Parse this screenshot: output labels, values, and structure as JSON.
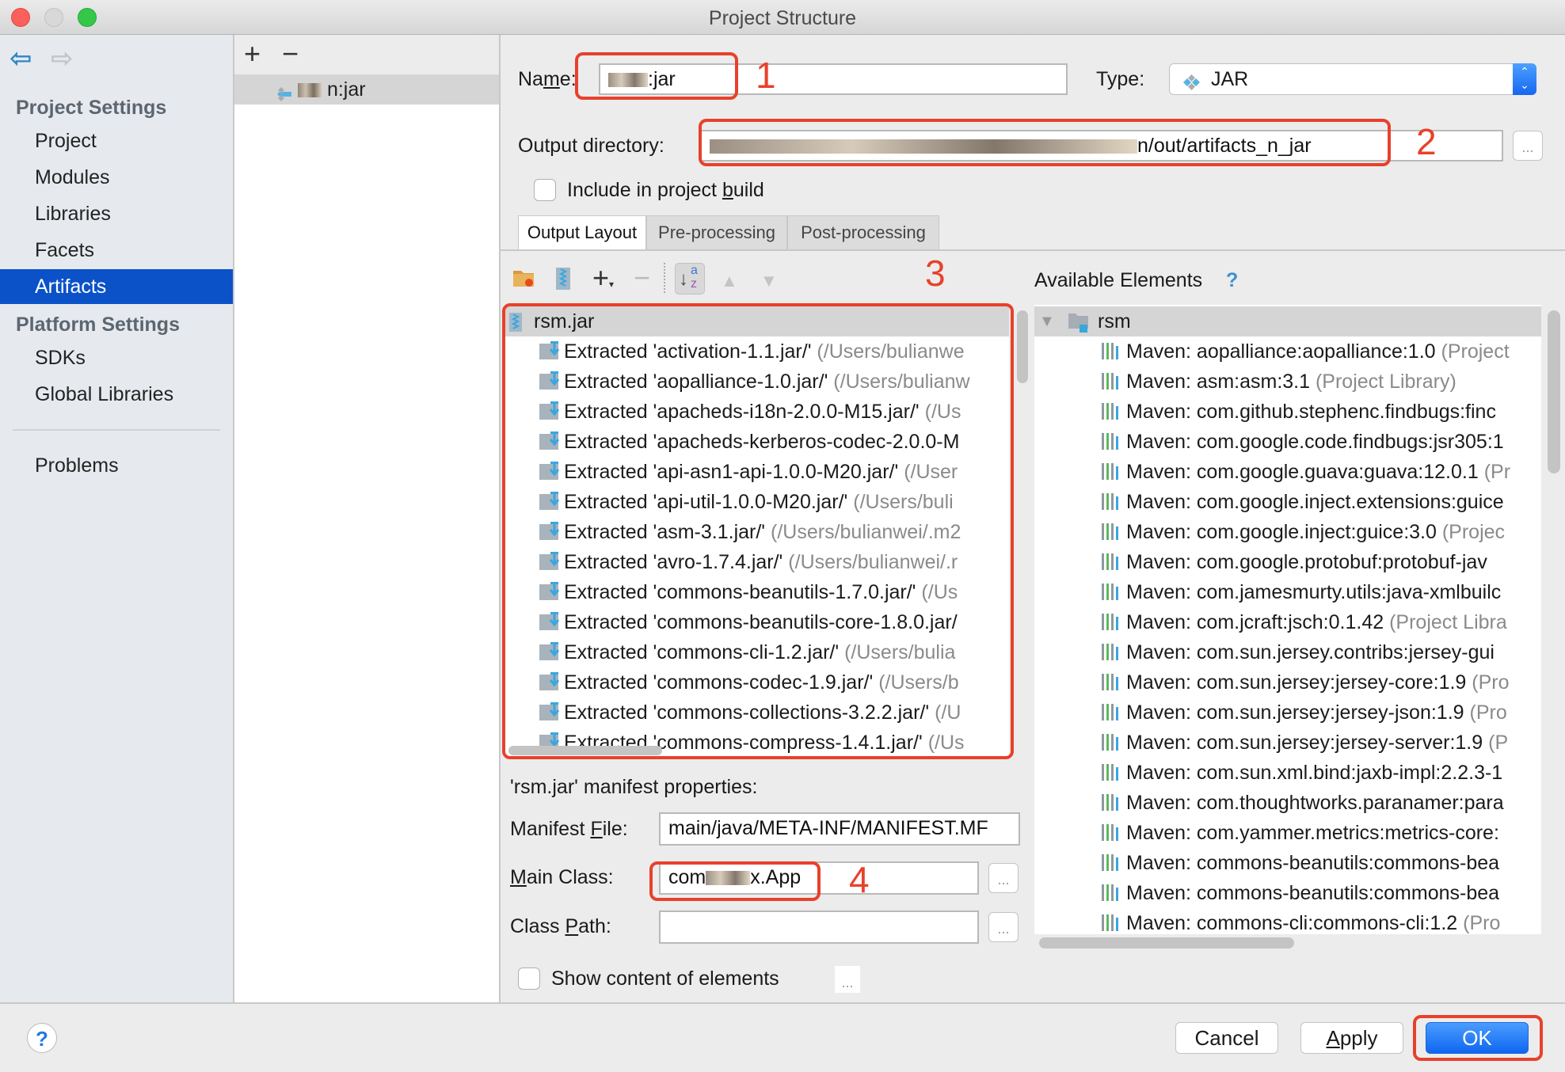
{
  "window": {
    "title": "Project Structure",
    "traffic_lights": [
      "close",
      "minimize",
      "zoom"
    ]
  },
  "sidebar": {
    "back_icon": "back-arrow-icon",
    "forward_icon": "forward-arrow-icon",
    "sections": [
      {
        "header": "Project Settings",
        "items": [
          "Project",
          "Modules",
          "Libraries",
          "Facets",
          "Artifacts"
        ]
      },
      {
        "header": "Platform Settings",
        "items": [
          "SDKs",
          "Global Libraries"
        ]
      }
    ],
    "selected": "Artifacts",
    "bottom_items": [
      "Problems"
    ]
  },
  "artifact_list": {
    "add_label": "+",
    "remove_label": "−",
    "items": [
      {
        "name": "n:jar",
        "name_obscured": true
      }
    ]
  },
  "artifact": {
    "name_label": "Name:",
    "name_value": ":jar",
    "type_label": "Type:",
    "type_value": "JAR",
    "output_dir_label": "Output directory:",
    "output_dir_value": "n/out/artifacts_n_jar",
    "include_label": "Include in project build",
    "include_checked": false
  },
  "tabs": [
    {
      "label": "Output Layout",
      "active": true
    },
    {
      "label": "Pre-processing",
      "active": false
    },
    {
      "label": "Post-processing",
      "active": false
    }
  ],
  "output_layout": {
    "toolbar_icons": [
      "new-folder-icon",
      "archive-icon",
      "add-icon",
      "remove-icon",
      "sort-az-icon",
      "move-up-icon",
      "move-down-icon"
    ],
    "root": "rsm.jar",
    "items": [
      {
        "label": "Extracted 'activation-1.1.jar/'",
        "path": "(/Users/bulianwe"
      },
      {
        "label": "Extracted 'aopalliance-1.0.jar/'",
        "path": "(/Users/bulianw"
      },
      {
        "label": "Extracted 'apacheds-i18n-2.0.0-M15.jar/'",
        "path": "(/Us"
      },
      {
        "label": "Extracted 'apacheds-kerberos-codec-2.0.0-M",
        "path": ""
      },
      {
        "label": "Extracted 'api-asn1-api-1.0.0-M20.jar/'",
        "path": "(/User"
      },
      {
        "label": "Extracted 'api-util-1.0.0-M20.jar/'",
        "path": "(/Users/buli"
      },
      {
        "label": "Extracted 'asm-3.1.jar/'",
        "path": "(/Users/bulianwei/.m2"
      },
      {
        "label": "Extracted 'avro-1.7.4.jar/'",
        "path": "(/Users/bulianwei/.r"
      },
      {
        "label": "Extracted 'commons-beanutils-1.7.0.jar/'",
        "path": "(/Us"
      },
      {
        "label": "Extracted 'commons-beanutils-core-1.8.0.jar/",
        "path": ""
      },
      {
        "label": "Extracted 'commons-cli-1.2.jar/'",
        "path": "(/Users/bulia"
      },
      {
        "label": "Extracted 'commons-codec-1.9.jar/'",
        "path": "(/Users/b"
      },
      {
        "label": "Extracted 'commons-collections-3.2.2.jar/'",
        "path": "(/U"
      },
      {
        "label": "Extracted 'commons-compress-1.4.1.jar/'",
        "path": "(/Us"
      }
    ]
  },
  "available_elements": {
    "title": "Available Elements",
    "help": "?",
    "root": "rsm",
    "items": [
      {
        "label": "Maven: aopalliance:aopalliance:1.0",
        "suffix": "(Project"
      },
      {
        "label": "Maven: asm:asm:3.1",
        "suffix": "(Project Library)"
      },
      {
        "label": "Maven: com.github.stephenc.findbugs:finc",
        "suffix": ""
      },
      {
        "label": "Maven: com.google.code.findbugs:jsr305:1",
        "suffix": ""
      },
      {
        "label": "Maven: com.google.guava:guava:12.0.1",
        "suffix": "(Pr"
      },
      {
        "label": "Maven: com.google.inject.extensions:guice",
        "suffix": ""
      },
      {
        "label": "Maven: com.google.inject:guice:3.0",
        "suffix": "(Projec"
      },
      {
        "label": "Maven: com.google.protobuf:protobuf-jav",
        "suffix": ""
      },
      {
        "label": "Maven: com.jamesmurty.utils:java-xmlbuilc",
        "suffix": ""
      },
      {
        "label": "Maven: com.jcraft:jsch:0.1.42",
        "suffix": "(Project Libra"
      },
      {
        "label": "Maven: com.sun.jersey.contribs:jersey-gui",
        "suffix": ""
      },
      {
        "label": "Maven: com.sun.jersey:jersey-core:1.9",
        "suffix": "(Pro"
      },
      {
        "label": "Maven: com.sun.jersey:jersey-json:1.9",
        "suffix": "(Pro"
      },
      {
        "label": "Maven: com.sun.jersey:jersey-server:1.9",
        "suffix": "(P"
      },
      {
        "label": "Maven: com.sun.xml.bind:jaxb-impl:2.2.3-1",
        "suffix": ""
      },
      {
        "label": "Maven: com.thoughtworks.paranamer:para",
        "suffix": ""
      },
      {
        "label": "Maven: com.yammer.metrics:metrics-core:",
        "suffix": ""
      },
      {
        "label": "Maven: commons-beanutils:commons-bea",
        "suffix": ""
      },
      {
        "label": "Maven: commons-beanutils:commons-bea",
        "suffix": ""
      },
      {
        "label": "Maven: commons-cli:commons-cli:1.2",
        "suffix": "(Pro"
      }
    ]
  },
  "manifest": {
    "title": "'rsm.jar' manifest properties:",
    "file_label": "Manifest File:",
    "file_value": "main/java/META-INF/MANIFEST.MF",
    "main_class_label": "Main Class:",
    "main_class_value": "com.x.App",
    "class_path_label": "Class Path:",
    "class_path_value": "",
    "show_content_label": "Show content of elements",
    "show_content_checked": false,
    "browse_label": "..."
  },
  "annotations": [
    "1",
    "2",
    "3",
    "4"
  ],
  "footer": {
    "help_label": "?",
    "cancel_label": "Cancel",
    "apply_label": "Apply",
    "ok_label": "OK"
  },
  "colors": {
    "selection": "#0b52c9",
    "annotation_red": "#e8412b",
    "primary_button": "#1568f0"
  }
}
